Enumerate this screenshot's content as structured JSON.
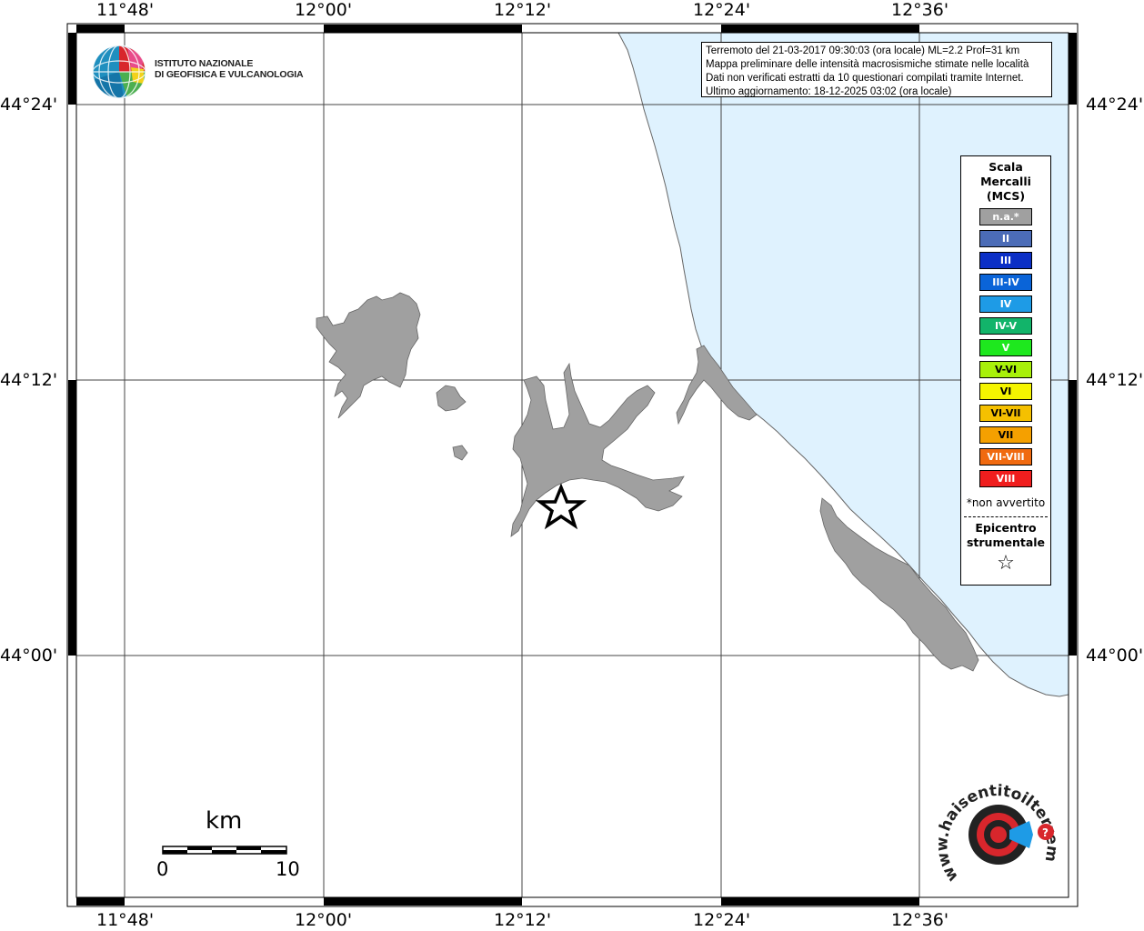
{
  "map": {
    "top_lon_labels": [
      "11°48'",
      "12°00'",
      "12°12'",
      "12°24'",
      "12°36'"
    ],
    "bottom_lon_labels": [
      "11°48'",
      "12°00'",
      "12°12'",
      "12°24'",
      "12°36'"
    ],
    "left_lat_labels": [
      "44°24'",
      "44°12'",
      "44°00'"
    ],
    "right_lat_labels": [
      "44°24'",
      "44°12'",
      "44°00'"
    ],
    "sea_color": "#dff2fe",
    "land_color": "#ffffff",
    "locality_color": "#a0a0a0"
  },
  "institute": {
    "line1": "ISTITUTO NAZIONALE",
    "line2": "DI GEOFISICA E VULCANOLOGIA"
  },
  "info": {
    "line1": "Terremoto del 21-03-2017 09:30:03 (ora locale) ML=2.2 Prof=31 km",
    "line2": "Mappa preliminare delle intensità macrosismiche stimate nelle località",
    "line3": "Dati non verificati estratti da 10 questionari compilati tramite Internet.",
    "line4": "Ultimo aggiornamento: 18-12-2025 03:02 (ora locale)"
  },
  "legend": {
    "title1": "Scala",
    "title2": "Mercalli",
    "title3": "(MCS)",
    "classes": [
      {
        "label": "n.a.*",
        "color": "#a0a0a0"
      },
      {
        "label": "II",
        "color": "#4b6cb7"
      },
      {
        "label": "III",
        "color": "#0b2fc6"
      },
      {
        "label": "III-IV",
        "color": "#0a64d8"
      },
      {
        "label": "IV",
        "color": "#1e9be6"
      },
      {
        "label": "IV-V",
        "color": "#12b46a"
      },
      {
        "label": "V",
        "color": "#1ee81e"
      },
      {
        "label": "V-VI",
        "color": "#a8f00a"
      },
      {
        "label": "VI",
        "color": "#f5f500"
      },
      {
        "label": "VI-VII",
        "color": "#f5c000"
      },
      {
        "label": "VII",
        "color": "#f5a000"
      },
      {
        "label": "VII-VIII",
        "color": "#f06a10"
      },
      {
        "label": "VIII",
        "color": "#f01e1e"
      }
    ],
    "note": "*non avvertito",
    "epicenter1": "Epicentro",
    "epicenter2": "strumentale",
    "star": "☆"
  },
  "scale_bar": {
    "unit": "km",
    "min": "0",
    "max": "10"
  },
  "hsit": {
    "text": "www.haisentitoilterremoto.it"
  }
}
